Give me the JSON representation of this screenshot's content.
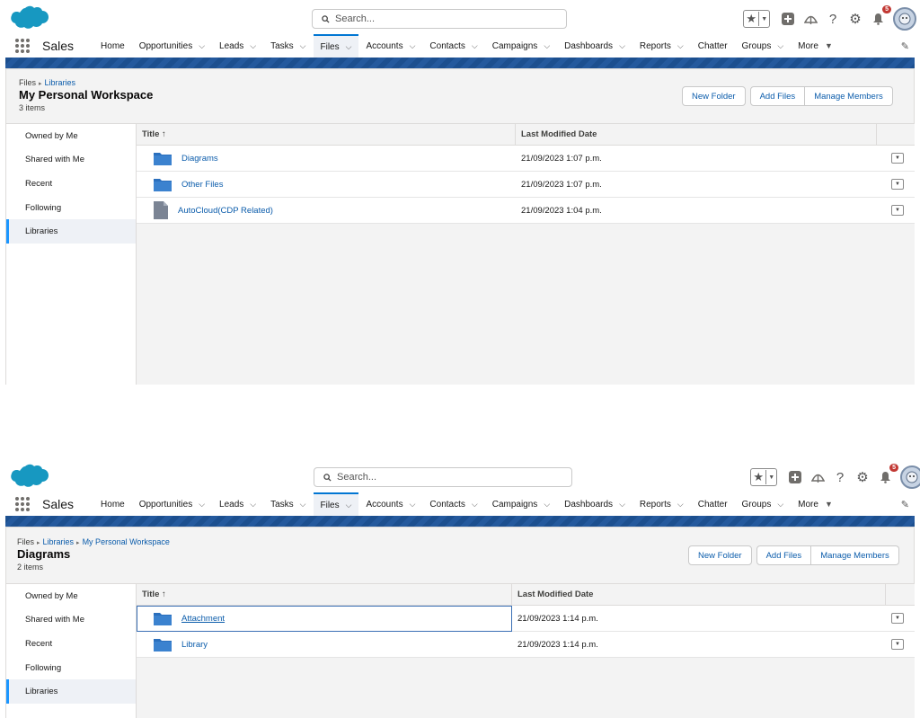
{
  "header": {
    "search_placeholder": "Search...",
    "notification_count": "5",
    "app_name": "Sales"
  },
  "nav": {
    "items": [
      {
        "label": "Home",
        "dropdown": false
      },
      {
        "label": "Opportunities",
        "dropdown": true
      },
      {
        "label": "Leads",
        "dropdown": true
      },
      {
        "label": "Tasks",
        "dropdown": true
      },
      {
        "label": "Files",
        "dropdown": true,
        "active": true
      },
      {
        "label": "Accounts",
        "dropdown": true
      },
      {
        "label": "Contacts",
        "dropdown": true
      },
      {
        "label": "Campaigns",
        "dropdown": true
      },
      {
        "label": "Dashboards",
        "dropdown": true
      },
      {
        "label": "Reports",
        "dropdown": true
      },
      {
        "label": "Chatter",
        "dropdown": false
      },
      {
        "label": "Groups",
        "dropdown": true
      },
      {
        "label": "More",
        "dropdown": true
      }
    ]
  },
  "sidebar": {
    "items": [
      "Owned by Me",
      "Shared with Me",
      "Recent",
      "Following",
      "Libraries"
    ]
  },
  "buttons": {
    "new_folder": "New Folder",
    "add_files": "Add Files",
    "manage_members": "Manage Members"
  },
  "table": {
    "col_title": "Title ↑",
    "col_date": "Last Modified Date"
  },
  "view1": {
    "crumb_1": "Files",
    "crumb_2": "Libraries",
    "title": "My Personal Workspace",
    "count": "3 items",
    "rows": [
      {
        "name": "Diagrams",
        "type": "folder",
        "date": "21/09/2023 1:07 p.m."
      },
      {
        "name": "Other Files",
        "type": "folder",
        "date": "21/09/2023 1:07 p.m."
      },
      {
        "name": "AutoCloud(CDP Related)",
        "type": "file",
        "date": "21/09/2023 1:04 p.m."
      }
    ]
  },
  "view2": {
    "crumb_1": "Files",
    "crumb_2": "Libraries",
    "crumb_3": "My Personal Workspace",
    "title": "Diagrams",
    "count": "2 items",
    "rows": [
      {
        "name": "Attachment",
        "type": "folder",
        "date": "21/09/2023 1:14 p.m.",
        "selected": true
      },
      {
        "name": "Library",
        "type": "folder",
        "date": "21/09/2023 1:14 p.m."
      }
    ]
  },
  "colors": {
    "brand_blue": "#0176d3",
    "link": "#0b5cab",
    "banner": "#1c4f8f",
    "folder": "#2a6fbd",
    "notification_red": "#c23934"
  }
}
